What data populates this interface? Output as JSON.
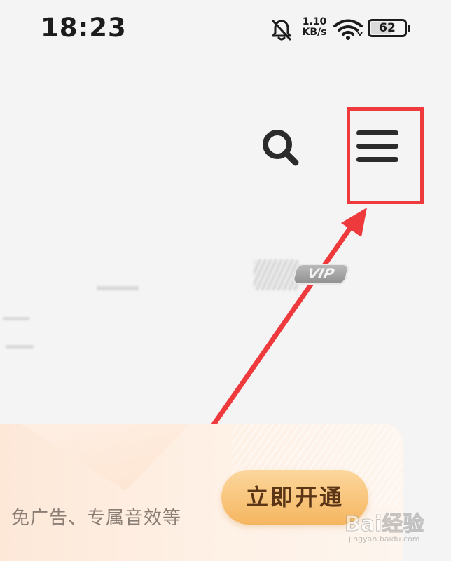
{
  "status_bar": {
    "time": "18:23",
    "net_speed_value": "1.10",
    "net_speed_unit": "KB/s",
    "battery_level": "62",
    "battery_fraction": 0.62,
    "icons": [
      "bell-off-icon",
      "wifi-icon",
      "battery-icon"
    ]
  },
  "header": {
    "icons": [
      "search-icon",
      "menu-icon"
    ]
  },
  "annotation": {
    "highlight_color": "#ee3a3d",
    "arrow_color": "#ee3a3d"
  },
  "vip_badge": {
    "label": "VIP"
  },
  "vip_banner": {
    "description": "免广告、专属音效等",
    "button_label": "立即开通",
    "button_color": "#f5b660",
    "background_color": "#fde8d8"
  },
  "watermark": {
    "brand": "Bai经验",
    "domain": "jingyan.baidu.com"
  }
}
